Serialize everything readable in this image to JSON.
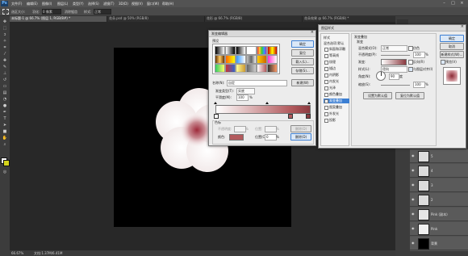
{
  "app": {
    "logo": "Ps"
  },
  "menu": {
    "items": [
      "文件(F)",
      "编辑(E)",
      "图像(I)",
      "图层(L)",
      "类型(Y)",
      "选择(S)",
      "滤镜(T)",
      "3D(D)",
      "视图(V)",
      "窗口(W)",
      "帮助(H)"
    ]
  },
  "options_bar": {
    "size_label": "选区大小:",
    "feather_label": "羽化:",
    "feather_value": "0 像素",
    "anti_alias": "消除锯齿",
    "style_label": "样式:",
    "style_value": "正常"
  },
  "tabs": [
    {
      "label": "未标题-1 @ 66.7% (图层 1, RGB/8#) *"
    },
    {
      "label": "花朵.psd @ 50% (RGB/8)"
    },
    {
      "label": "花形 @ 66.7% (RGB/8)"
    },
    {
      "label": "花朵效果 @ 66.7% (RGB/8) *"
    }
  ],
  "status": {
    "zoom": "66.67%",
    "doc": "文档:1.37M/6.41M"
  },
  "gradient_editor": {
    "title": "渐变编辑器",
    "presets_label": "预设",
    "buttons": {
      "ok": "确定",
      "cancel": "复位",
      "load": "载入(L)...",
      "save": "存储(S)..."
    },
    "name_label": "名称(N):",
    "name_value": "自定",
    "new_button": "新建(W)",
    "type_label": "渐变类型(T):",
    "type_value": "实底",
    "smooth_label": "平滑度(M):",
    "smooth_value": "100",
    "smooth_unit": "%",
    "stops_label": "色标",
    "opacity_label": "不透明度:",
    "opacity_unit": "%",
    "location_label": "位置:",
    "location_unit": "%",
    "delete_label": "删除(D)",
    "color_label": "颜色:",
    "location2_label": "位置(C):",
    "location2_value": "0",
    "location2_unit": "%",
    "delete2_label": "删除(D)",
    "stop_color": "#b25a5d",
    "gradient_left": "#ffffff",
    "gradient_right": "#8b3a40"
  },
  "layer_style": {
    "title": "图层样式",
    "styles_header": "样式",
    "blend_default": "混合选项:默认",
    "style_items": [
      "斜面和浮雕",
      "等高线",
      "纹理",
      "描边",
      "内阴影",
      "内发光",
      "光泽",
      "颜色叠加",
      "渐变叠加",
      "图案叠加",
      "外发光",
      "投影"
    ],
    "selected_item": "渐变叠加",
    "panel_title": "渐变叠加",
    "group_label": "渐变",
    "blend_mode_label": "混合模式(O):",
    "blend_mode_value": "正常",
    "dither_label": "仿色",
    "opacity_label": "不透明度(P):",
    "opacity_value": "100",
    "opacity_unit": "%",
    "gradient_label": "渐变:",
    "reverse_label": "反向(R)",
    "style_label": "样式(L):",
    "style_value": "径向",
    "align_label": "与图层对齐(I)",
    "angle_label": "角度(N):",
    "angle_value": "90",
    "angle_unit": "度",
    "scale_label": "缩放(S):",
    "scale_value": "100",
    "scale_unit": "%",
    "btn_default": "设置为默认值",
    "btn_reset": "复位为默认值",
    "buttons": {
      "ok": "确定",
      "cancel": "取消",
      "new_style": "新建样式(W)...",
      "preview": "预览(V)"
    }
  },
  "layers": [
    {
      "name": "5"
    },
    {
      "name": "4"
    },
    {
      "name": "3"
    },
    {
      "name": "2"
    },
    {
      "name": "Pink (副本)"
    },
    {
      "name": "Pink"
    },
    {
      "name": "背景"
    }
  ]
}
